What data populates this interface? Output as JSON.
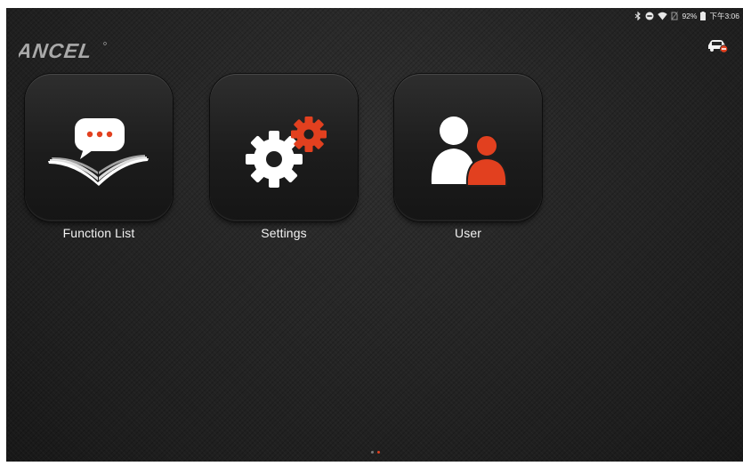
{
  "status_bar": {
    "battery_text": "92%",
    "time": "下午3:06",
    "icons": [
      "bluetooth-icon",
      "do-not-disturb-icon",
      "wifi-icon",
      "no-sim-icon",
      "battery-icon"
    ]
  },
  "brand": {
    "logo_text": "ANCEL"
  },
  "header": {
    "car_icon": "car-connection-icon"
  },
  "apps": [
    {
      "label": "Function List",
      "icon": "book-chat-icon"
    },
    {
      "label": "Settings",
      "icon": "gears-icon"
    },
    {
      "label": "User",
      "icon": "users-icon"
    }
  ],
  "pager": {
    "total_pages": 2,
    "current_page": 2
  },
  "colors": {
    "accent": "#e2401f",
    "background": "#252525",
    "icon_white": "#ffffff",
    "dot_inactive": "#7a7a7a"
  }
}
